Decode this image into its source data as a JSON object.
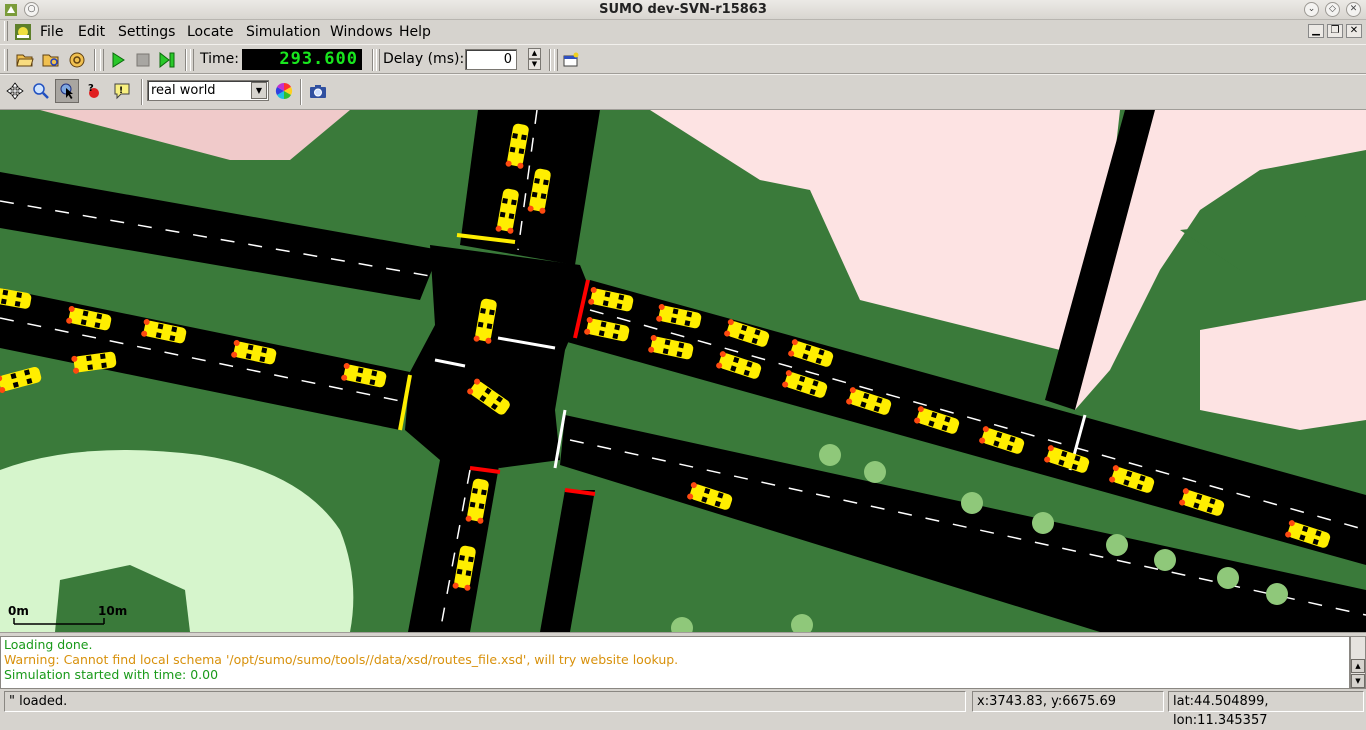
{
  "window": {
    "title": "SUMO dev-SVN-r15863"
  },
  "menu": [
    {
      "label": "File"
    },
    {
      "label": "Edit"
    },
    {
      "label": "Settings"
    },
    {
      "label": "Locate"
    },
    {
      "label": "Simulation"
    },
    {
      "label": "Windows"
    },
    {
      "label": "Help"
    }
  ],
  "toolbar": {
    "time_label": "Time:",
    "time_value": "293.600",
    "delay_label": "Delay (ms):",
    "delay_value": "0"
  },
  "view_toolbar": {
    "scheme_selected": "real world"
  },
  "map": {
    "scale_start": "0m",
    "scale_end": "10m",
    "colors": {
      "grass": "#3a7a3a",
      "building": "#fde3e3",
      "park_light": "#d6f5cc",
      "road": "#000000",
      "vehicle": "#ffee00",
      "signal_red": "#ff0000",
      "signal_yellow": "#ffee00"
    }
  },
  "messages": [
    {
      "text": "Loading done.",
      "kind": "ok"
    },
    {
      "text": "Warning: Cannot find local schema '/opt/sumo/sumo/tools//data/xsd/routes_file.xsd', will try website lookup.",
      "kind": "warn"
    },
    {
      "text": "Simulation started with time: 0.00",
      "kind": "ok"
    }
  ],
  "status": {
    "message": "\" loaded.",
    "coords": "x:3743.83, y:6675.69",
    "geo": "lat:44.504899, lon:11.345357"
  }
}
